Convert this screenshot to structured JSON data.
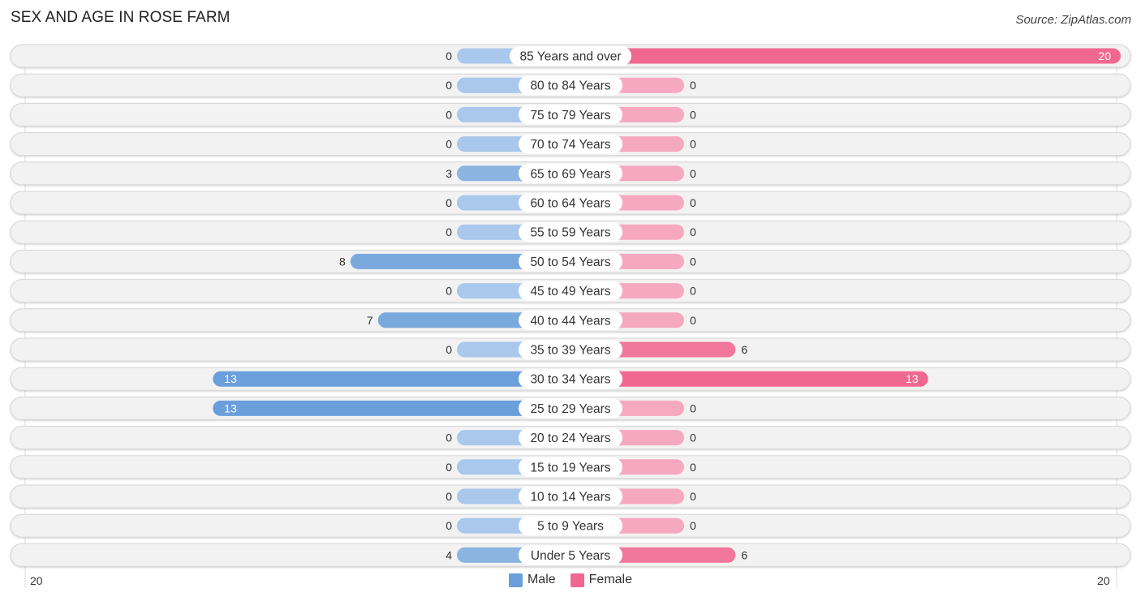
{
  "title": "SEX AND AGE IN ROSE FARM",
  "source": "Source: ZipAtlas.com",
  "colors": {
    "male": "#6a9fdb",
    "male_light": "#a9c8ec",
    "female": "#f06890",
    "female_light": "#f7a8c1",
    "row_bg": "#f2f2f2",
    "row_border": "#d6d6d6"
  },
  "chart_data": {
    "type": "bar",
    "orientation": "horizontal-diverging",
    "title": "SEX AND AGE IN ROSE FARM",
    "categories": [
      "85 Years and over",
      "80 to 84 Years",
      "75 to 79 Years",
      "70 to 74 Years",
      "65 to 69 Years",
      "60 to 64 Years",
      "55 to 59 Years",
      "50 to 54 Years",
      "45 to 49 Years",
      "40 to 44 Years",
      "35 to 39 Years",
      "30 to 34 Years",
      "25 to 29 Years",
      "20 to 24 Years",
      "15 to 19 Years",
      "10 to 14 Years",
      "5 to 9 Years",
      "Under 5 Years"
    ],
    "series": [
      {
        "name": "Male",
        "values": [
          0,
          0,
          0,
          0,
          3,
          0,
          0,
          8,
          0,
          7,
          0,
          13,
          13,
          0,
          0,
          0,
          0,
          4
        ]
      },
      {
        "name": "Female",
        "values": [
          20,
          0,
          0,
          0,
          0,
          0,
          0,
          0,
          0,
          0,
          6,
          13,
          0,
          0,
          0,
          0,
          0,
          6
        ]
      }
    ],
    "xlim": [
      -20,
      20
    ],
    "axis_ticks": {
      "left": "20",
      "right": "20"
    },
    "legend": {
      "position": "bottom-center",
      "entries": [
        "Male",
        "Female"
      ]
    }
  }
}
